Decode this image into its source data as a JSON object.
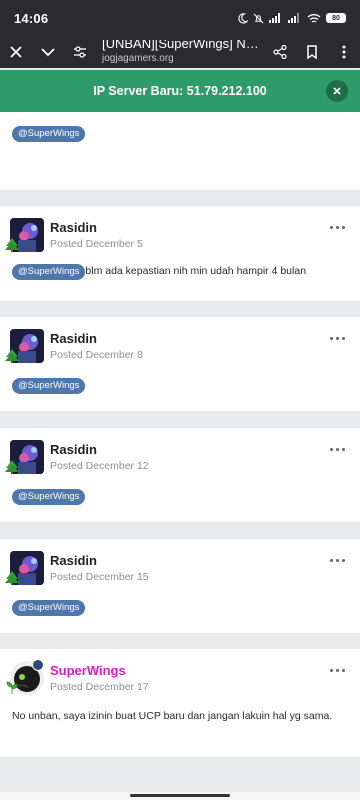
{
  "status_bar": {
    "time": "14:06",
    "battery": "80"
  },
  "browser": {
    "title": "[UNBAN][SuperWings] Norre...",
    "domain": "jogjagamers.org"
  },
  "notice": {
    "text": "IP Server Baru: 51.79.212.100"
  },
  "posts": [
    {
      "mention": "@SuperWings"
    },
    {
      "author": "Rasidin",
      "posted": "Posted December 5",
      "mention": "@SuperWings",
      "text": "blm ada kepastian nih min udah hampir 4 bulan"
    },
    {
      "author": "Rasidin",
      "posted": "Posted December 8",
      "mention": "@SuperWings"
    },
    {
      "author": "Rasidin",
      "posted": "Posted December 12",
      "mention": "@SuperWings"
    },
    {
      "author": "Rasidin",
      "posted": "Posted December 15",
      "mention": "@SuperWings"
    },
    {
      "author": "SuperWings",
      "posted": "Posted December 17",
      "text": "No unban, saya izinin buat UCP baru dan jangan lakuin hal yg sama."
    }
  ],
  "colors": {
    "notice_bg": "#2f9a6a",
    "mention_bg": "#4f77a9",
    "staff_name": "#d61fbe"
  }
}
